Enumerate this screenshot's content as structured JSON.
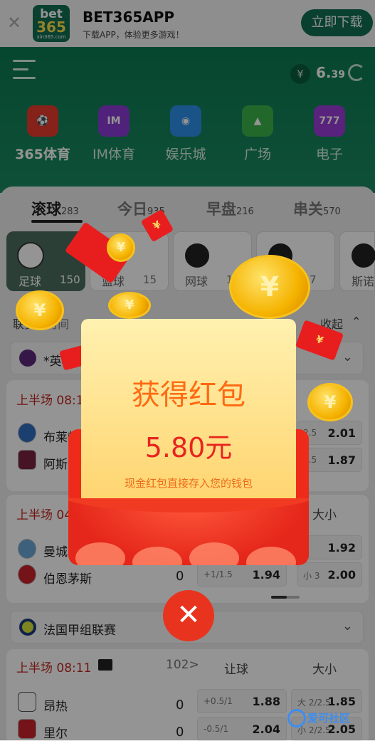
{
  "app_banner": {
    "title": "BET365APP",
    "subtitle": "下载APP，体验更多游戏！",
    "download_label": "立即下载",
    "logo_top": "bet",
    "logo_mid": "365",
    "logo_url_text": "xin365.com"
  },
  "header": {
    "currency": "¥",
    "balance_int": "6.",
    "balance_dec": "39"
  },
  "categories": [
    {
      "label": "365体育",
      "icon": "soccer-ball-icon",
      "color": "#e83b2d"
    },
    {
      "label": "IM体育",
      "icon": "im-logo-icon",
      "color": "#8b3bd6"
    },
    {
      "label": "娱乐城",
      "icon": "casino-chip-icon",
      "color": "#2b8fe8"
    },
    {
      "label": "广场",
      "icon": "graduation-cap-icon",
      "color": "#3cb44a"
    },
    {
      "label": "电子",
      "icon": "slot-777-icon",
      "color": "#9a3bd6"
    }
  ],
  "tabs": [
    {
      "label": "滚球",
      "count": "283"
    },
    {
      "label": "今日",
      "count": "935"
    },
    {
      "label": "早盘",
      "count": "216"
    },
    {
      "label": "串关",
      "count": "570"
    }
  ],
  "sports": [
    {
      "label": "足球",
      "count": "150"
    },
    {
      "label": "篮球",
      "count": "15"
    },
    {
      "label": "网球",
      "count": "1"
    },
    {
      "label": "",
      "count": "7"
    },
    {
      "label": "斯诺",
      "count": ""
    }
  ],
  "sortbar": {
    "left": "联赛",
    "time": "时间",
    "collapse": "收起"
  },
  "leagues": [
    {
      "name": "*英格"
    },
    {
      "name": "法国甲组联赛"
    }
  ],
  "matches": [
    {
      "half": "上半场 08:1",
      "home": "布莱顿",
      "away": "阿斯",
      "home_score": "",
      "away_score": "",
      "odds": [
        [
          "2.5",
          "2.01"
        ],
        [
          "2.5",
          "1.87"
        ]
      ]
    },
    {
      "half": "上半场 04",
      "home": "曼城",
      "away": "伯恩茅斯",
      "home_score": "",
      "away_score": "0",
      "col_ou": "大小",
      "odds": [
        [
          "",
          "1.92"
        ],
        [
          "小 3",
          "2.00"
        ]
      ],
      "hcap": [
        [
          "",
          ""
        ],
        [
          "+1/1.5",
          "1.94"
        ]
      ]
    },
    {
      "half": "上半场 08:11",
      "more": "102>",
      "col_hcap": "让球",
      "col_ou": "大小",
      "home": "昂热",
      "away": "里尔",
      "home_score": "0",
      "away_score": "0",
      "hcap": [
        [
          "+0.5/1",
          "1.88"
        ],
        [
          "-0.5/1",
          "2.04"
        ]
      ],
      "odds": [
        [
          "大 2/2.5",
          "1.85"
        ],
        [
          "小 2/2.5",
          "2.05"
        ]
      ]
    }
  ],
  "popup": {
    "title": "获得红包",
    "amount": "5.80元",
    "note": "现金红包直接存入您的钱包",
    "close_symbol": "✕",
    "coin_symbol": "¥",
    "envelope_symbol": "¥"
  },
  "watermark": {
    "text": "爱可社区"
  }
}
